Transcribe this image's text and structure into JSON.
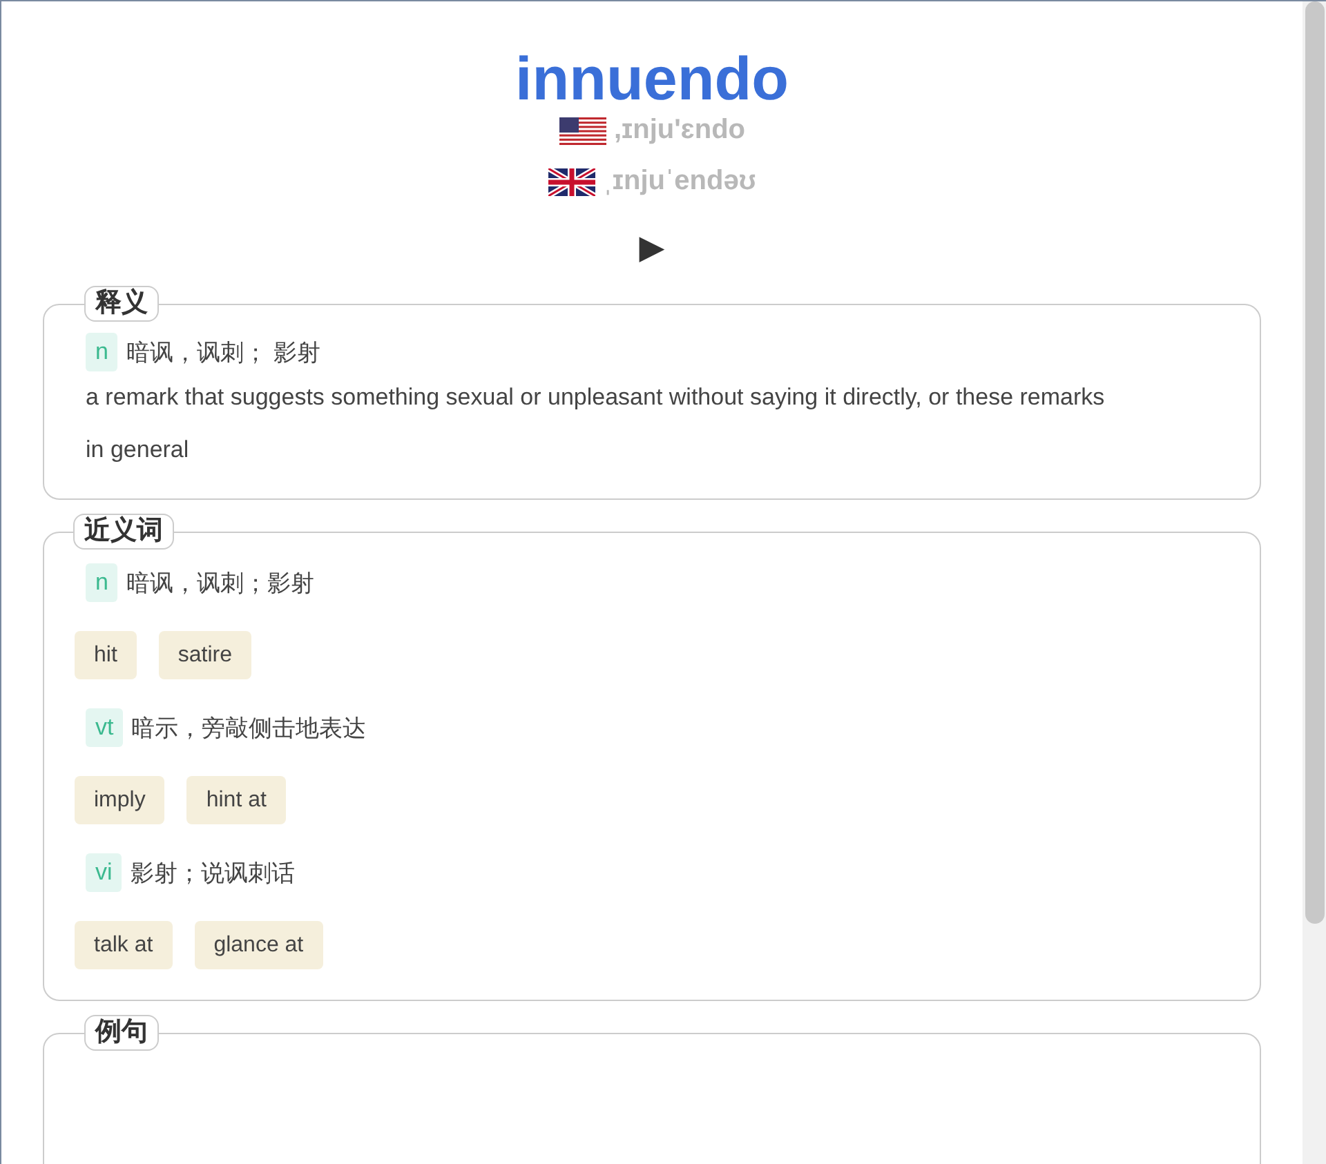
{
  "headword": "innuendo",
  "pronunciations": [
    {
      "kind": "us",
      "phonetic": ",ɪnju'ɛndo"
    },
    {
      "kind": "uk",
      "phonetic": "ˌɪnjuˈendəʊ"
    }
  ],
  "play_button": "▶",
  "sections": [
    {
      "kind": "definition",
      "title": "释义",
      "entries": [
        {
          "pos": "n",
          "meaning": "暗讽，讽刺； 影射",
          "definition": "a remark that suggests something sexual or unpleasant without saying it directly, or these remarks in general"
        }
      ]
    },
    {
      "kind": "synonyms",
      "title": "近义词",
      "groups": [
        {
          "pos": "n",
          "meaning": "暗讽，讽刺；影射",
          "words": [
            "hit",
            "satire"
          ]
        },
        {
          "pos": "vt",
          "meaning": "暗示，旁敲侧击地表达",
          "words": [
            "imply",
            "hint at"
          ]
        },
        {
          "pos": "vi",
          "meaning": "影射；说讽刺话",
          "words": [
            "talk at",
            "glance at"
          ]
        }
      ]
    },
    {
      "kind": "examples",
      "title": "例句"
    }
  ]
}
